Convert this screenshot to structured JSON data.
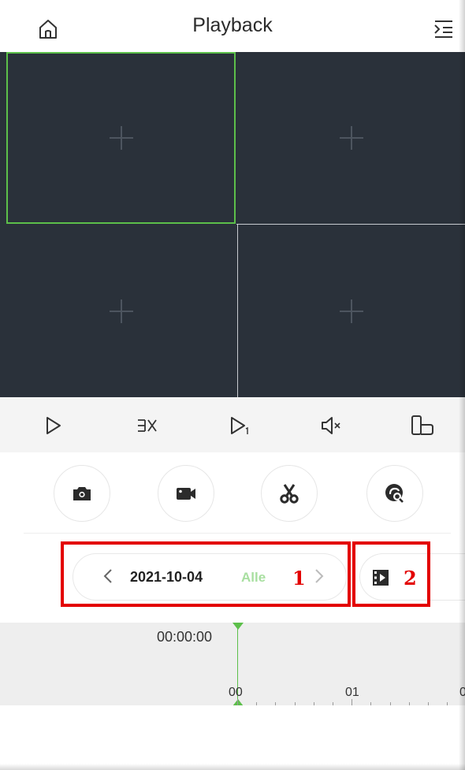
{
  "header": {
    "title": "Playback",
    "home_icon": "home-icon",
    "menu_icon": "menu-collapse-icon"
  },
  "video_grid": {
    "cells": [
      {
        "state": "selected",
        "icon": "add-channel-icon"
      },
      {
        "state": "empty",
        "icon": "add-channel-icon"
      },
      {
        "state": "empty",
        "icon": "add-channel-icon"
      },
      {
        "state": "empty",
        "icon": "add-channel-icon"
      }
    ],
    "selected_color": "#5cbf4a",
    "background_color": "#2a313a"
  },
  "toolbar": {
    "buttons": [
      {
        "name": "play-icon"
      },
      {
        "name": "speed-icon"
      },
      {
        "name": "single-frame-icon"
      },
      {
        "name": "mute-icon"
      },
      {
        "name": "rotate-screen-icon"
      }
    ]
  },
  "functions": {
    "buttons": [
      {
        "name": "snapshot-icon"
      },
      {
        "name": "record-icon"
      },
      {
        "name": "clip-icon"
      },
      {
        "name": "search-icon"
      }
    ]
  },
  "date_selector": {
    "date": "2021-10-04",
    "filter": "Alle",
    "filter_color": "#a8dfa0"
  },
  "clip_list": {
    "icon": "video-file-icon"
  },
  "annotations": {
    "label_1": "1",
    "label_2": "2",
    "color": "#e30000"
  },
  "timeline": {
    "current_time": "00:00:00",
    "labels": [
      "00",
      "01",
      "0"
    ],
    "cursor_color": "#5cbf4a"
  }
}
